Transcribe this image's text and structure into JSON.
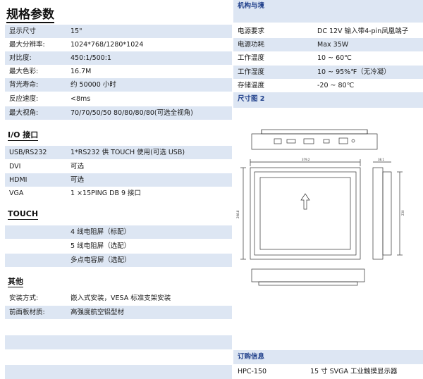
{
  "title": "规格参数",
  "display": [
    {
      "k": "显示尺寸",
      "v": "15\""
    },
    {
      "k": "最大分辨率:",
      "v": "1024*768/1280*1024"
    },
    {
      "k": "对比度:",
      "v": "450:1/500:1"
    },
    {
      "k": "最大色彩:",
      "v": "16.7M"
    },
    {
      "k": "背光寿命:",
      "v": "约 50000 小时"
    },
    {
      "k": "反应速度:",
      "v": "<8ms"
    },
    {
      "k": "最大视角:",
      "v": "70/70/50/50   80/80/80/80(可选全视角)"
    }
  ],
  "io": {
    "heading": "I/O 接口",
    "rows": [
      {
        "k": "USB/RS232",
        "v": "1*RS232 供 TOUCH 使用(可选 USB)"
      },
      {
        "k": "DVI",
        "v": "可选"
      },
      {
        "k": "HDMI",
        "v": "可选"
      },
      {
        "k": "VGA",
        "v": "1 ×15PING DB 9 接口"
      }
    ]
  },
  "touch": {
    "heading": "TOUCH",
    "rows": [
      "4 线电阻屏（标配）",
      "5 线电阻屏（选配）",
      "多点电容屏（选配）"
    ]
  },
  "other": {
    "heading": "其他",
    "rows": [
      {
        "k": "安装方式:",
        "v": "嵌入式安装，VESA 标准支架安装"
      },
      {
        "k": "前面板材质:",
        "v": "高强度航空铝型材"
      }
    ]
  },
  "env": {
    "heading": "机构与境",
    "rows": [
      {
        "k": "电源要求",
        "v": "DC 12V 输入带4-pin凤凰端子"
      },
      {
        "k": "电源功耗",
        "v": "Max   35W"
      },
      {
        "k": "工作温度",
        "v": "10 ~ 60℃"
      },
      {
        "k": "工作湿度",
        "v": "10 ~ 95%℉（无冷凝）"
      },
      {
        "k": "存储温度",
        "v": "-20 ~ 80℃"
      }
    ]
  },
  "drawing": {
    "heading": "尺寸图 2",
    "dim_width": "379.2",
    "dim_height": "298.8",
    "dim_inner_height": "230",
    "dim_depth": "38.1"
  },
  "order": {
    "heading": "订购信息",
    "model": "HPC-150",
    "desc": "15 寸 SVGA 工业触摸显示器"
  }
}
